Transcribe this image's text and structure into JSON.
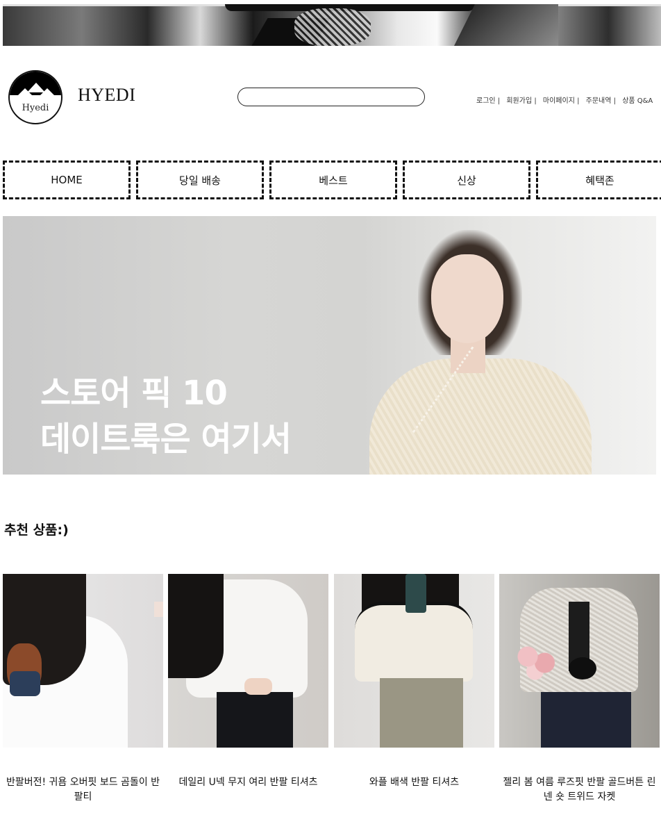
{
  "header": {
    "brand_name": "HYEDI",
    "logo_text": "Hyedi",
    "search": {
      "value": "",
      "placeholder": ""
    },
    "links": [
      "로그인 |",
      "회원가입 |",
      "마이페이지 |",
      "주문내역 |",
      "상품 Q&A"
    ]
  },
  "nav": {
    "items": [
      "HOME",
      "당일 배송",
      "베스트",
      "신상",
      "혜택존"
    ]
  },
  "hero": {
    "line1": "스토어 픽 10",
    "line2": "데이트룩은 여기서"
  },
  "recommend": {
    "title": "추천 상품:)",
    "products": [
      {
        "name": "반팔버전! 귀욤 오버핏 보드 곰돌이 반팔티"
      },
      {
        "name": "데일리 U넥 무지 여리 반팔 티셔츠"
      },
      {
        "name": "와플 배색 반팔 티셔츠"
      },
      {
        "name": "젤리 봄 여름 루즈핏 반팔 골드버튼 린넨 숏 트위드 자켓"
      }
    ]
  }
}
